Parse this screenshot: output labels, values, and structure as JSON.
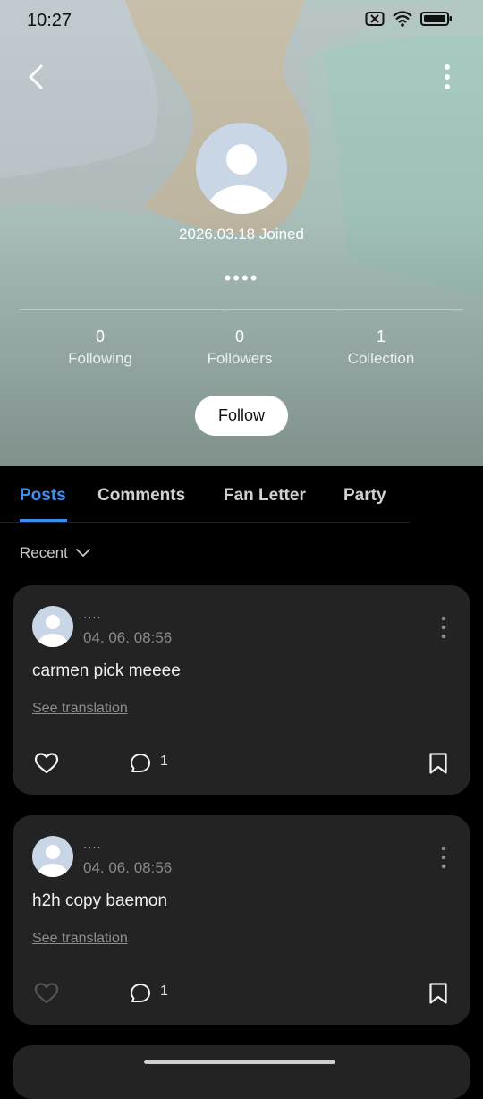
{
  "status_bar": {
    "time": "10:27"
  },
  "profile": {
    "joined": "2026.03.18 Joined",
    "name": "••••",
    "stats": [
      {
        "value": "0",
        "label": "Following"
      },
      {
        "value": "0",
        "label": "Followers"
      },
      {
        "value": "1",
        "label": "Collection"
      }
    ],
    "follow_label": "Follow"
  },
  "tabs": [
    {
      "label": "Posts",
      "active": true
    },
    {
      "label": "Comments",
      "active": false
    },
    {
      "label": "Fan Letter",
      "active": false
    },
    {
      "label": "Party",
      "active": false
    }
  ],
  "sort_label": "Recent",
  "posts": [
    {
      "username": "....",
      "date": "04. 06. 08:56",
      "text": "carmen pick meeee",
      "translate_label": "See translation",
      "comment_count": "1"
    },
    {
      "username": "....",
      "date": "04. 06. 08:56",
      "text": "h2h copy baemon",
      "translate_label": "See translation",
      "comment_count": "1"
    }
  ],
  "colors": {
    "accent": "#3d8ef0",
    "card_bg": "#232323"
  }
}
